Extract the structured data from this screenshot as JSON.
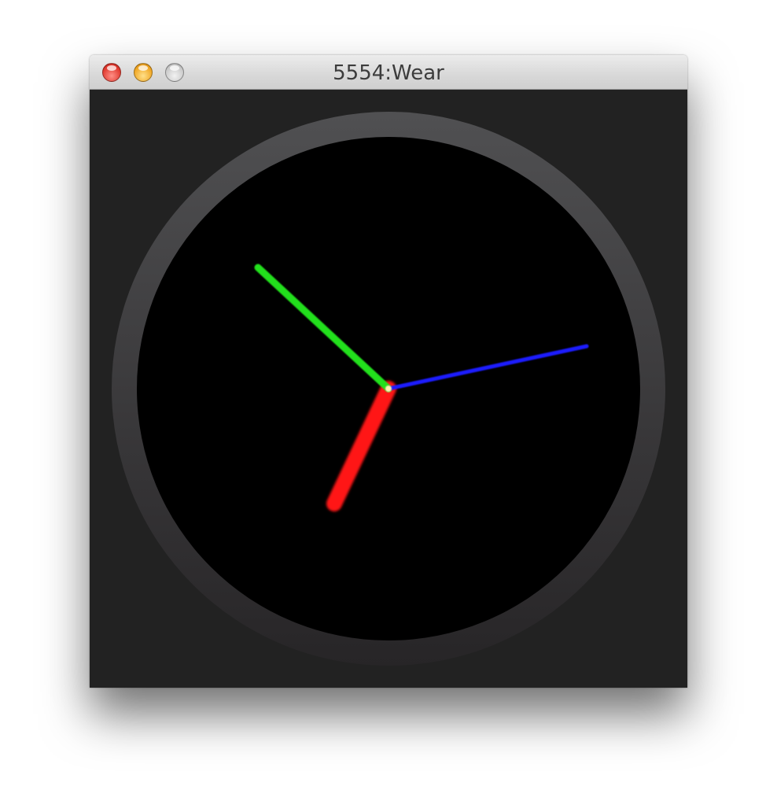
{
  "window": {
    "title": "5554:Wear"
  },
  "traffic_lights": {
    "close": "close-button",
    "minimize": "minimize-button",
    "zoom": "zoom-button"
  },
  "watch_face": {
    "type": "analog-clock",
    "background_color": "#222222",
    "bezel_color": "#4a4a4c",
    "dial_color": "#000000",
    "hands": [
      {
        "name": "hour",
        "color": "#ff1a1a"
      },
      {
        "name": "minute",
        "color": "#22e01a"
      },
      {
        "name": "second",
        "color": "#1a1aff"
      }
    ]
  }
}
